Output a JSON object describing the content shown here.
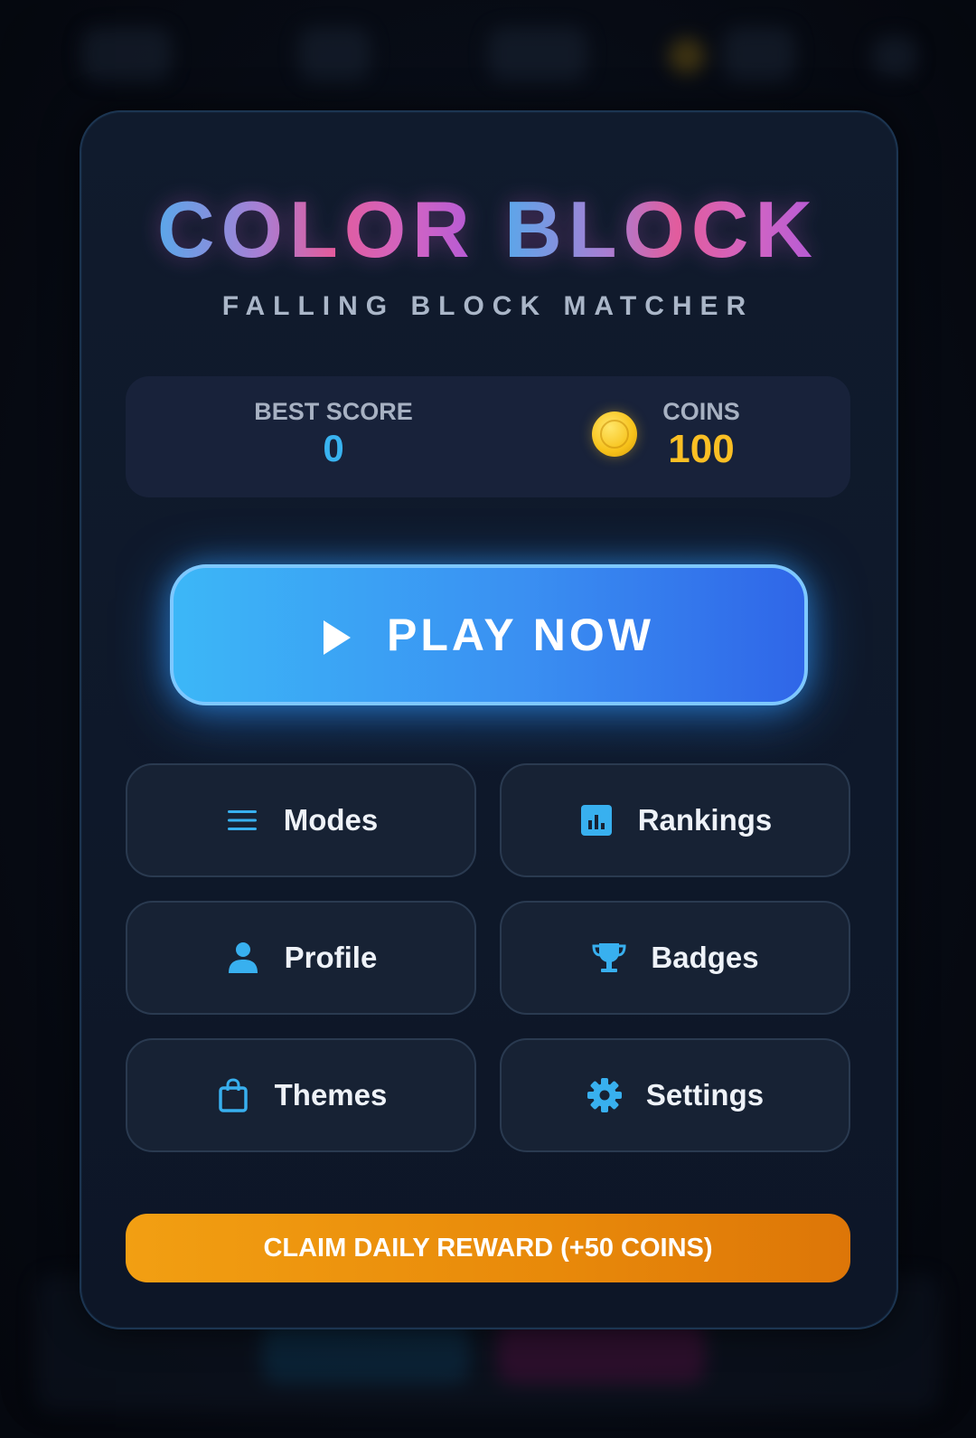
{
  "title": {
    "part1": "COLOR",
    "part2": "BLOCK"
  },
  "subtitle": "FALLING BLOCK MATCHER",
  "stats": {
    "best_label": "BEST SCORE",
    "best_value": "0",
    "coins_label": "COINS",
    "coins_value": "100"
  },
  "play": {
    "label": "PLAY NOW",
    "icon": "play-icon"
  },
  "menu": [
    {
      "label": "Modes",
      "icon": "list-icon"
    },
    {
      "label": "Rankings",
      "icon": "bar-chart-icon"
    },
    {
      "label": "Profile",
      "icon": "person-icon"
    },
    {
      "label": "Badges",
      "icon": "trophy-icon"
    },
    {
      "label": "Themes",
      "icon": "shopping-bag-icon"
    },
    {
      "label": "Settings",
      "icon": "gear-icon"
    }
  ],
  "claim": {
    "label": "CLAIM DAILY REWARD (+50 COINS)"
  },
  "colors": {
    "accent_blue": "#39b3f0",
    "coin_gold": "#fbbf24",
    "claim_orange": "#f29f12",
    "play_gradient_start": "#3cb7f7",
    "play_gradient_end": "#2f66e8"
  }
}
